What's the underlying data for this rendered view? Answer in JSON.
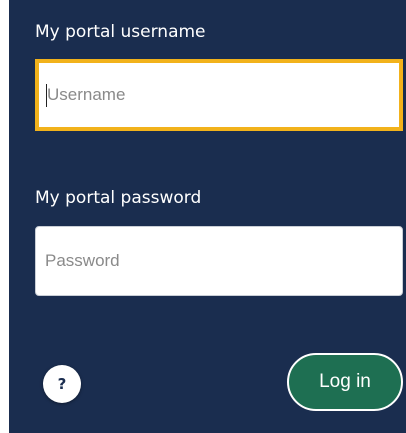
{
  "login_form": {
    "username_label": "My portal username",
    "username_placeholder": "Username",
    "password_label": "My portal password",
    "password_placeholder": "Password",
    "help_label": "?",
    "login_label": "Log in"
  },
  "colors": {
    "panel_background": "#1a2d4f",
    "focus_border": "#f2b21b",
    "login_button": "#1e6f52",
    "text": "#ffffff"
  },
  "icons": {
    "help": "question-mark-icon"
  }
}
